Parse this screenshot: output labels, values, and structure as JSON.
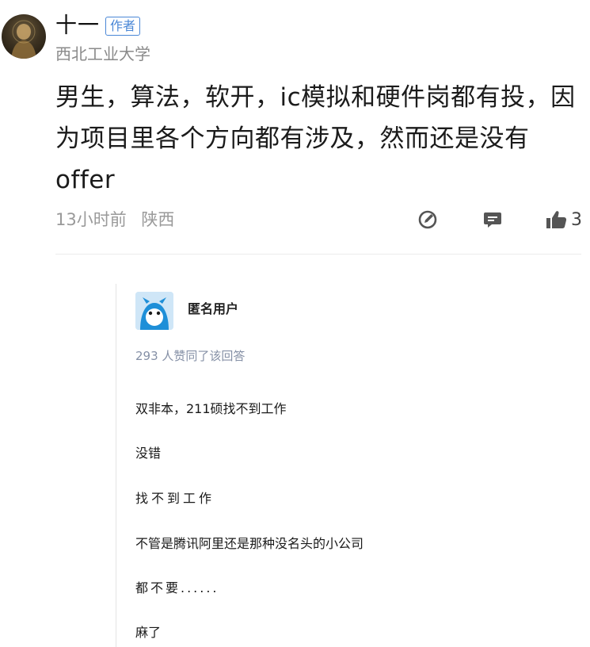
{
  "author": {
    "name": "十一",
    "tag": "作者",
    "school": "西北工业大学",
    "avatar_icon": "user-avatar-photo"
  },
  "post": {
    "body": "男生，算法，软开，ic模拟和硬件岗都有投，因为项目里各个方向都有涉及，然而还是没有offer",
    "time": "13小时前",
    "location": "陕西"
  },
  "actions": {
    "edit_icon": "edit-icon",
    "reply_icon": "comment-icon",
    "like_icon": "thumbs-up-icon",
    "like_count": "3"
  },
  "quote": {
    "user_name": "匿名用户",
    "avatar_icon": "anonymous-avatar",
    "agree_text": "293 人赞同了该回答",
    "lines": [
      "双非本，211硕找不到工作",
      "没错",
      "找不到工作",
      "不管是腾讯阿里还是那种没名头的小公司",
      "都不要......",
      "麻了"
    ]
  },
  "colors": {
    "tag_blue": "#4a87d6",
    "meta_gray": "#9a9a9a",
    "agree_gray": "#8590a6"
  }
}
